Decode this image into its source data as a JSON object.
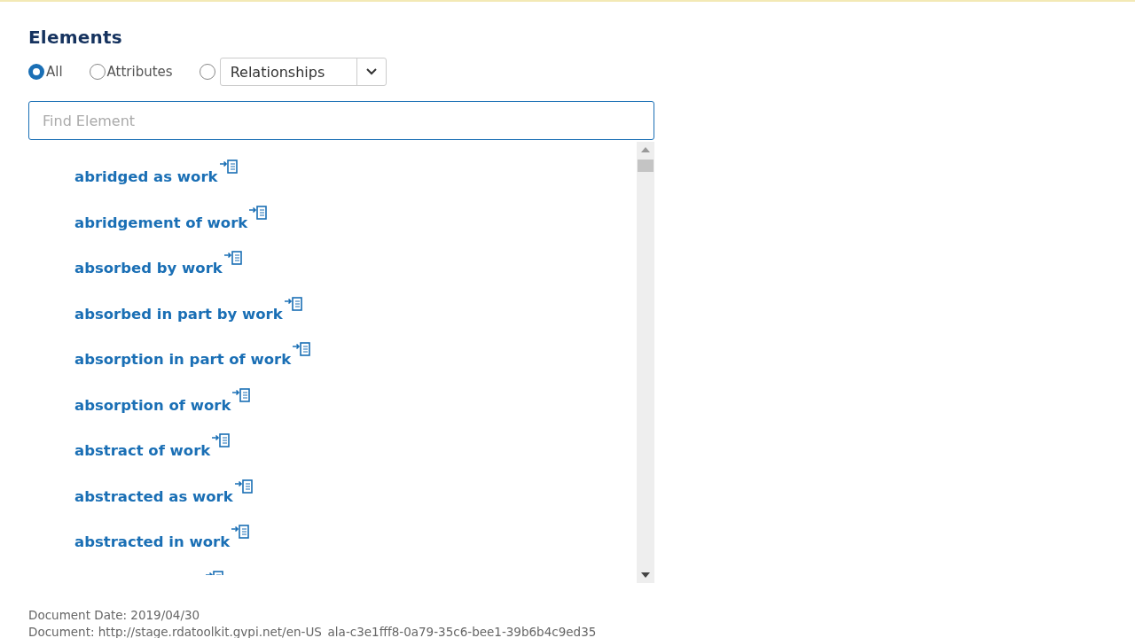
{
  "heading": "Elements",
  "filters": [
    {
      "kind": "radio",
      "label": "All",
      "selected": true
    },
    {
      "kind": "radio",
      "label": "Attributes",
      "selected": false
    },
    {
      "kind": "dropdown",
      "label": "Relationships",
      "selected": false
    }
  ],
  "search": {
    "placeholder": "Find Element"
  },
  "elements": [
    {
      "kind": "item",
      "label": "abridged as work"
    },
    {
      "kind": "item",
      "label": "abridgement of work"
    },
    {
      "kind": "item",
      "label": "absorbed by work"
    },
    {
      "kind": "item",
      "label": "absorbed in part by work"
    },
    {
      "kind": "item",
      "label": "absorption in part of work"
    },
    {
      "kind": "item",
      "label": "absorption of work"
    },
    {
      "kind": "item",
      "label": "abstract of work"
    },
    {
      "kind": "item",
      "label": "abstracted as work"
    },
    {
      "kind": "item",
      "label": "abstracted in work"
    },
    {
      "kind": "cut"
    }
  ],
  "footer": [
    "Document Date: 2019/04/30",
    "Document: http://stage.rdatoolkit.gvpi.net/en-US_ala-c3e1fff8-0a79-35c6-bee1-39b6b4c9ed35"
  ]
}
